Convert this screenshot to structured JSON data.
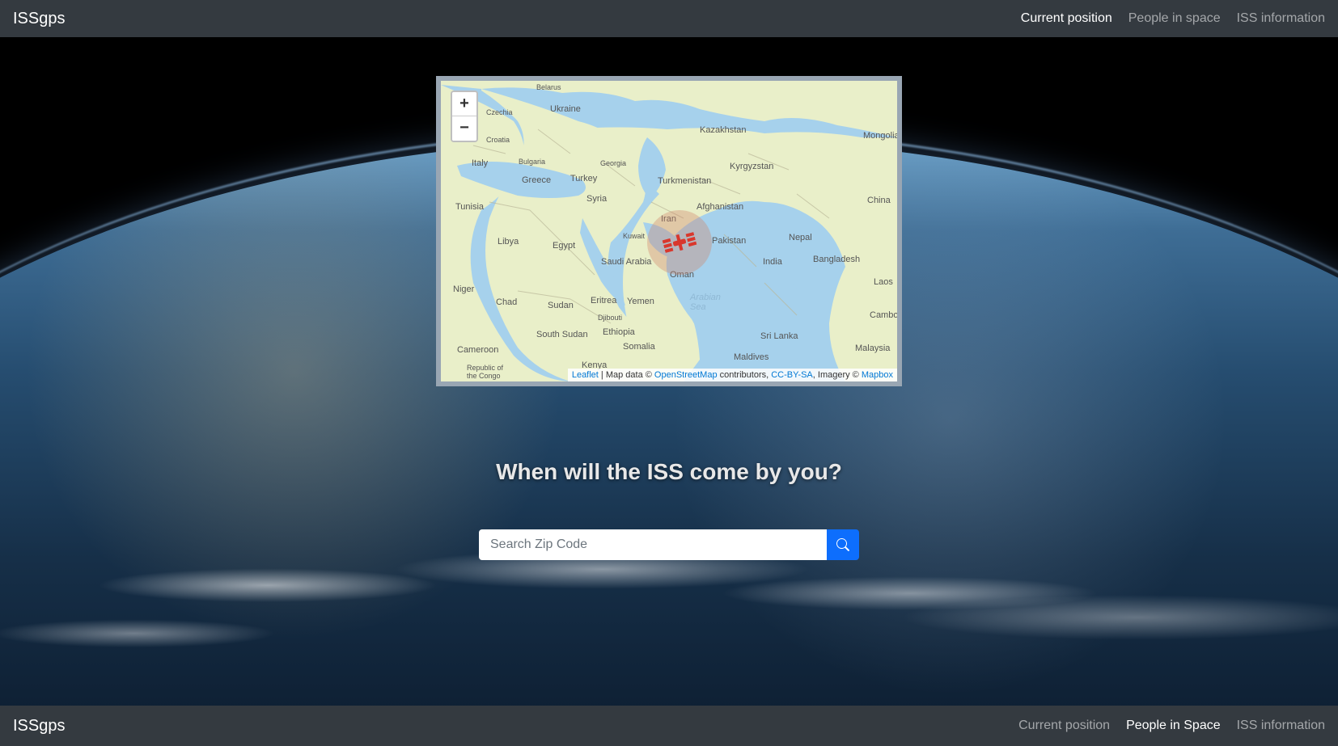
{
  "brand": "ISSgps",
  "nav": {
    "top": [
      {
        "label": "Current position",
        "active": true
      },
      {
        "label": "People in space",
        "active": false
      },
      {
        "label": "ISS information",
        "active": false
      }
    ],
    "footer": [
      {
        "label": "Current position",
        "active": false
      },
      {
        "label": "People in Space",
        "active": true
      },
      {
        "label": "ISS information",
        "active": false
      }
    ]
  },
  "map": {
    "zoom_in": "+",
    "zoom_out": "−",
    "iss_location_label": "Iran",
    "attribution": {
      "leaflet": "Leaflet",
      "sep1": " | Map data © ",
      "osm": "OpenStreetMap",
      "sep2": " contributors, ",
      "ccbysa": "CC-BY-SA",
      "sep3": ", Imagery © ",
      "mapbox": "Mapbox"
    },
    "labels": {
      "italy": "Italy",
      "tunisia": "Tunisia",
      "libya": "Libya",
      "egypt": "Egypt",
      "niger": "Niger",
      "chad": "Chad",
      "sudan": "Sudan",
      "eritrea": "Eritrea",
      "ethiopia": "Ethiopia",
      "south_sudan": "South Sudan",
      "kenya": "Kenya",
      "somalia": "Somalia",
      "djibouti": "Djibouti",
      "yemen": "Yemen",
      "cameroon": "Cameroon",
      "congo": "Republic of\nthe Congo",
      "greece": "Greece",
      "turkey": "Turkey",
      "syria": "Syria",
      "ukraine": "Ukraine",
      "belarus": "Belarus",
      "czechia": "Czechia",
      "croatia": "Croatia",
      "bulgaria": "Bulgaria",
      "georgia": "Georgia",
      "turkmenistan": "Turkmenistan",
      "kazakhstan": "Kazakhstan",
      "kyrgyzstan": "Kyrgyzstan",
      "mongolia": "Mongolia",
      "china": "China",
      "afghanistan": "Afghanistan",
      "pakistan": "Pakistan",
      "iran": "Iran",
      "kuwait": "Kuwait",
      "saudi": "Saudi Arabia",
      "oman": "Oman",
      "india": "India",
      "nepal": "Nepal",
      "bangladesh": "Bangladesh",
      "laos": "Laos",
      "cambodia": "Cambo",
      "malaysia": "Malaysia",
      "srilanka": "Sri Lanka",
      "maldives": "Maldives",
      "arabian_sea": "Arabian\nSea"
    }
  },
  "search": {
    "heading": "When will the ISS come by you?",
    "placeholder": "Search Zip Code"
  }
}
